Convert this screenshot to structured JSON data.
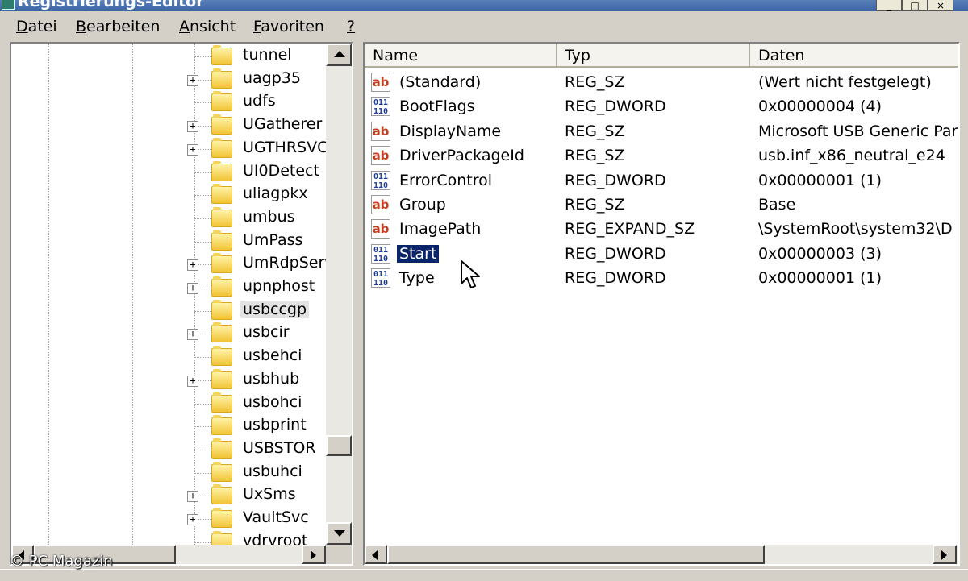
{
  "window": {
    "title": "Registrierungs-Editor"
  },
  "menu": [
    {
      "accel": "D",
      "rest": "atei"
    },
    {
      "accel": "B",
      "rest": "earbeiten"
    },
    {
      "accel": "A",
      "rest": "nsicht"
    },
    {
      "accel": "F",
      "rest": "avoriten"
    },
    {
      "accel": "?",
      "rest": ""
    }
  ],
  "tree": {
    "items": [
      {
        "label": "tunnel",
        "expandable": false,
        "selected": false
      },
      {
        "label": "uagp35",
        "expandable": true,
        "selected": false
      },
      {
        "label": "udfs",
        "expandable": false,
        "selected": false
      },
      {
        "label": "UGatherer",
        "expandable": true,
        "selected": false
      },
      {
        "label": "UGTHRSVC",
        "expandable": true,
        "selected": false
      },
      {
        "label": "UI0Detect",
        "expandable": false,
        "selected": false
      },
      {
        "label": "uliagpkx",
        "expandable": false,
        "selected": false
      },
      {
        "label": "umbus",
        "expandable": false,
        "selected": false
      },
      {
        "label": "UmPass",
        "expandable": false,
        "selected": false
      },
      {
        "label": "UmRdpServi",
        "expandable": true,
        "selected": false
      },
      {
        "label": "upnphost",
        "expandable": true,
        "selected": false
      },
      {
        "label": "usbccgp",
        "expandable": false,
        "selected": true
      },
      {
        "label": "usbcir",
        "expandable": true,
        "selected": false
      },
      {
        "label": "usbehci",
        "expandable": false,
        "selected": false
      },
      {
        "label": "usbhub",
        "expandable": true,
        "selected": false
      },
      {
        "label": "usbohci",
        "expandable": false,
        "selected": false
      },
      {
        "label": "usbprint",
        "expandable": false,
        "selected": false
      },
      {
        "label": "USBSTOR",
        "expandable": false,
        "selected": false
      },
      {
        "label": "usbuhci",
        "expandable": false,
        "selected": false
      },
      {
        "label": "UxSms",
        "expandable": true,
        "selected": false
      },
      {
        "label": "VaultSvc",
        "expandable": true,
        "selected": false
      },
      {
        "label": "vdrvroot",
        "expandable": false,
        "selected": false
      }
    ]
  },
  "list": {
    "columns": [
      "Name",
      "Typ",
      "Daten"
    ],
    "rows": [
      {
        "kind": "string",
        "name": "(Standard)",
        "type": "REG_SZ",
        "data": "(Wert nicht festgelegt)",
        "selected": false
      },
      {
        "kind": "binary",
        "name": "BootFlags",
        "type": "REG_DWORD",
        "data": "0x00000004 (4)",
        "selected": false
      },
      {
        "kind": "string",
        "name": "DisplayName",
        "type": "REG_SZ",
        "data": "Microsoft USB Generic Par",
        "selected": false
      },
      {
        "kind": "string",
        "name": "DriverPackageId",
        "type": "REG_SZ",
        "data": "usb.inf_x86_neutral_e24",
        "selected": false
      },
      {
        "kind": "binary",
        "name": "ErrorControl",
        "type": "REG_DWORD",
        "data": "0x00000001 (1)",
        "selected": false
      },
      {
        "kind": "string",
        "name": "Group",
        "type": "REG_SZ",
        "data": "Base",
        "selected": false
      },
      {
        "kind": "string",
        "name": "ImagePath",
        "type": "REG_EXPAND_SZ",
        "data": "\\SystemRoot\\system32\\D",
        "selected": false
      },
      {
        "kind": "binary",
        "name": "Start",
        "type": "REG_DWORD",
        "data": "0x00000003 (3)",
        "selected": true
      },
      {
        "kind": "binary",
        "name": "Type",
        "type": "REG_DWORD",
        "data": "0x00000001 (1)",
        "selected": false
      }
    ]
  },
  "icons": {
    "string_value": "string-value-icon",
    "binary_value": "binary-value-icon",
    "folder": "folder-icon"
  },
  "icon_text": {
    "string": "ab",
    "binary": "011\n110"
  },
  "watermark": "© PC Magazin",
  "colors": {
    "selection": "#0a246a",
    "folder": "#f2c436",
    "string_icon": "#c83c1e",
    "binary_icon": "#1e3c9a"
  }
}
